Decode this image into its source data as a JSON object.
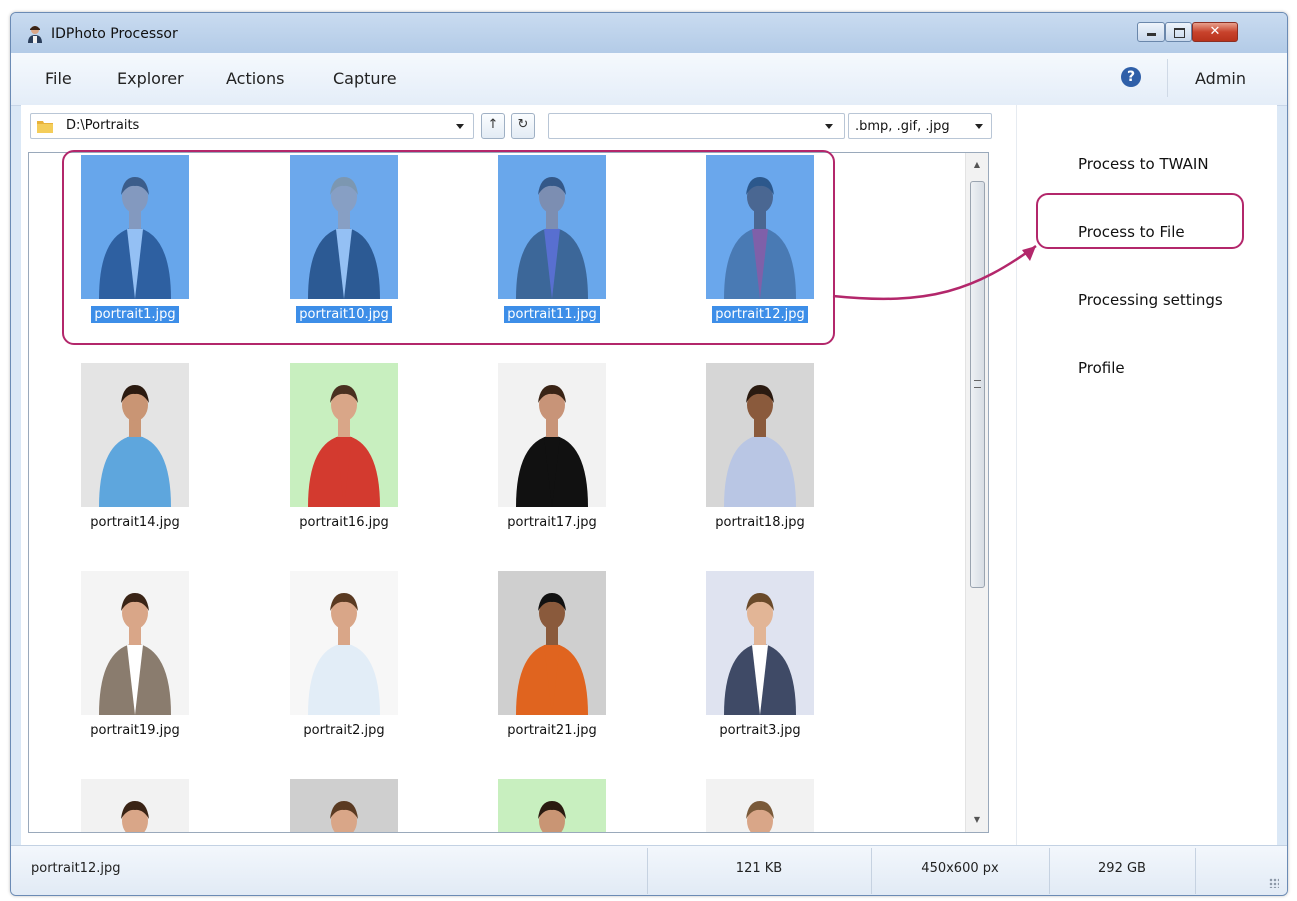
{
  "window": {
    "title": "IDPhoto Processor"
  },
  "menu": {
    "items": [
      "File",
      "Explorer",
      "Actions",
      "Capture"
    ],
    "user": "Admin"
  },
  "toolbar": {
    "path": "D:\\Portraits",
    "filter_value": "",
    "extensions": ".bmp, .gif, .jpg",
    "up_icon": "up-arrow-icon",
    "refresh_icon": "refresh-icon"
  },
  "files": [
    {
      "name": "portrait1.jpg",
      "selected": true,
      "bg": "#9cc6ea",
      "top": "#1d2a47",
      "shirt": "#ffffff",
      "skin": "#d9a98a",
      "hair": "#3a2518"
    },
    {
      "name": "portrait10.jpg",
      "selected": true,
      "bg": "#a7cbee",
      "top": "#1a1d2a",
      "shirt": "#ffffff",
      "skin": "#e2b596",
      "hair": "#c9a56a"
    },
    {
      "name": "portrait11.jpg",
      "selected": true,
      "bg": "#9fc7ec",
      "top": "#3d3a35",
      "shirt": "#7a4db0",
      "skin": "#c9906d",
      "hair": "#2a1a10"
    },
    {
      "name": "portrait12.jpg",
      "selected": true,
      "bg": "#a3c8ed",
      "top": "#5a6572",
      "shirt": "#d02a5a",
      "skin": "#5c3a26",
      "hair": "#1a1a1a"
    },
    {
      "name": "portrait14.jpg",
      "selected": false,
      "bg": "#e4e4e4",
      "top": "#5ea6dd",
      "shirt": "#5ea6dd",
      "skin": "#c99574",
      "hair": "#2b1a10"
    },
    {
      "name": "portrait16.jpg",
      "selected": false,
      "bg": "#c8efbf",
      "top": "#d33a2f",
      "shirt": "#d33a2f",
      "skin": "#d9a688",
      "hair": "#4a3020"
    },
    {
      "name": "portrait17.jpg",
      "selected": false,
      "bg": "#f2f2f2",
      "top": "#111111",
      "shirt": "#111111",
      "skin": "#c89478",
      "hair": "#3a2416"
    },
    {
      "name": "portrait18.jpg",
      "selected": false,
      "bg": "#d6d6d6",
      "top": "#b9c6e4",
      "shirt": "#b9c6e4",
      "skin": "#8a5a3c",
      "hair": "#2a1a10"
    },
    {
      "name": "portrait19.jpg",
      "selected": false,
      "bg": "#f4f4f4",
      "top": "#8a7c6e",
      "shirt": "#ffffff",
      "skin": "#d9a688",
      "hair": "#3a2416"
    },
    {
      "name": "portrait2.jpg",
      "selected": false,
      "bg": "#f7f7f7",
      "top": "#e2edf7",
      "shirt": "#e2edf7",
      "skin": "#d9a688",
      "hair": "#5a3a22"
    },
    {
      "name": "portrait21.jpg",
      "selected": false,
      "bg": "#cfcfcf",
      "top": "#e0641f",
      "shirt": "#e0641f",
      "skin": "#8a5a3c",
      "hair": "#111111"
    },
    {
      "name": "portrait3.jpg",
      "selected": false,
      "bg": "#dfe3f0",
      "top": "#3f4a66",
      "shirt": "#ffffff",
      "skin": "#e2b596",
      "hair": "#6a4a2a"
    },
    {
      "name": "",
      "selected": false,
      "bg": "#f2f2f2",
      "top": "#333333",
      "shirt": "#333333",
      "skin": "#d9a688",
      "hair": "#3a2416"
    },
    {
      "name": "",
      "selected": false,
      "bg": "#cfcfcf",
      "top": "#333333",
      "shirt": "#333333",
      "skin": "#d9a688",
      "hair": "#5a3a22"
    },
    {
      "name": "",
      "selected": false,
      "bg": "#c8efbf",
      "top": "#333333",
      "shirt": "#333333",
      "skin": "#c99574",
      "hair": "#2a1a10"
    },
    {
      "name": "",
      "selected": false,
      "bg": "#f2f2f2",
      "top": "#333333",
      "shirt": "#333333",
      "skin": "#d9a688",
      "hair": "#7a5a3a"
    }
  ],
  "actions": {
    "items": [
      "Process to TWAIN",
      "Process to File",
      "Processing settings",
      "Profile"
    ],
    "highlighted": "Process to File"
  },
  "status": {
    "filename": "portrait12.jpg",
    "size": "121 KB",
    "dimensions": "450x600 px",
    "free_space": "292 GB"
  },
  "colors": {
    "highlight": "#b3276b",
    "selection": "#3d8ee8"
  }
}
